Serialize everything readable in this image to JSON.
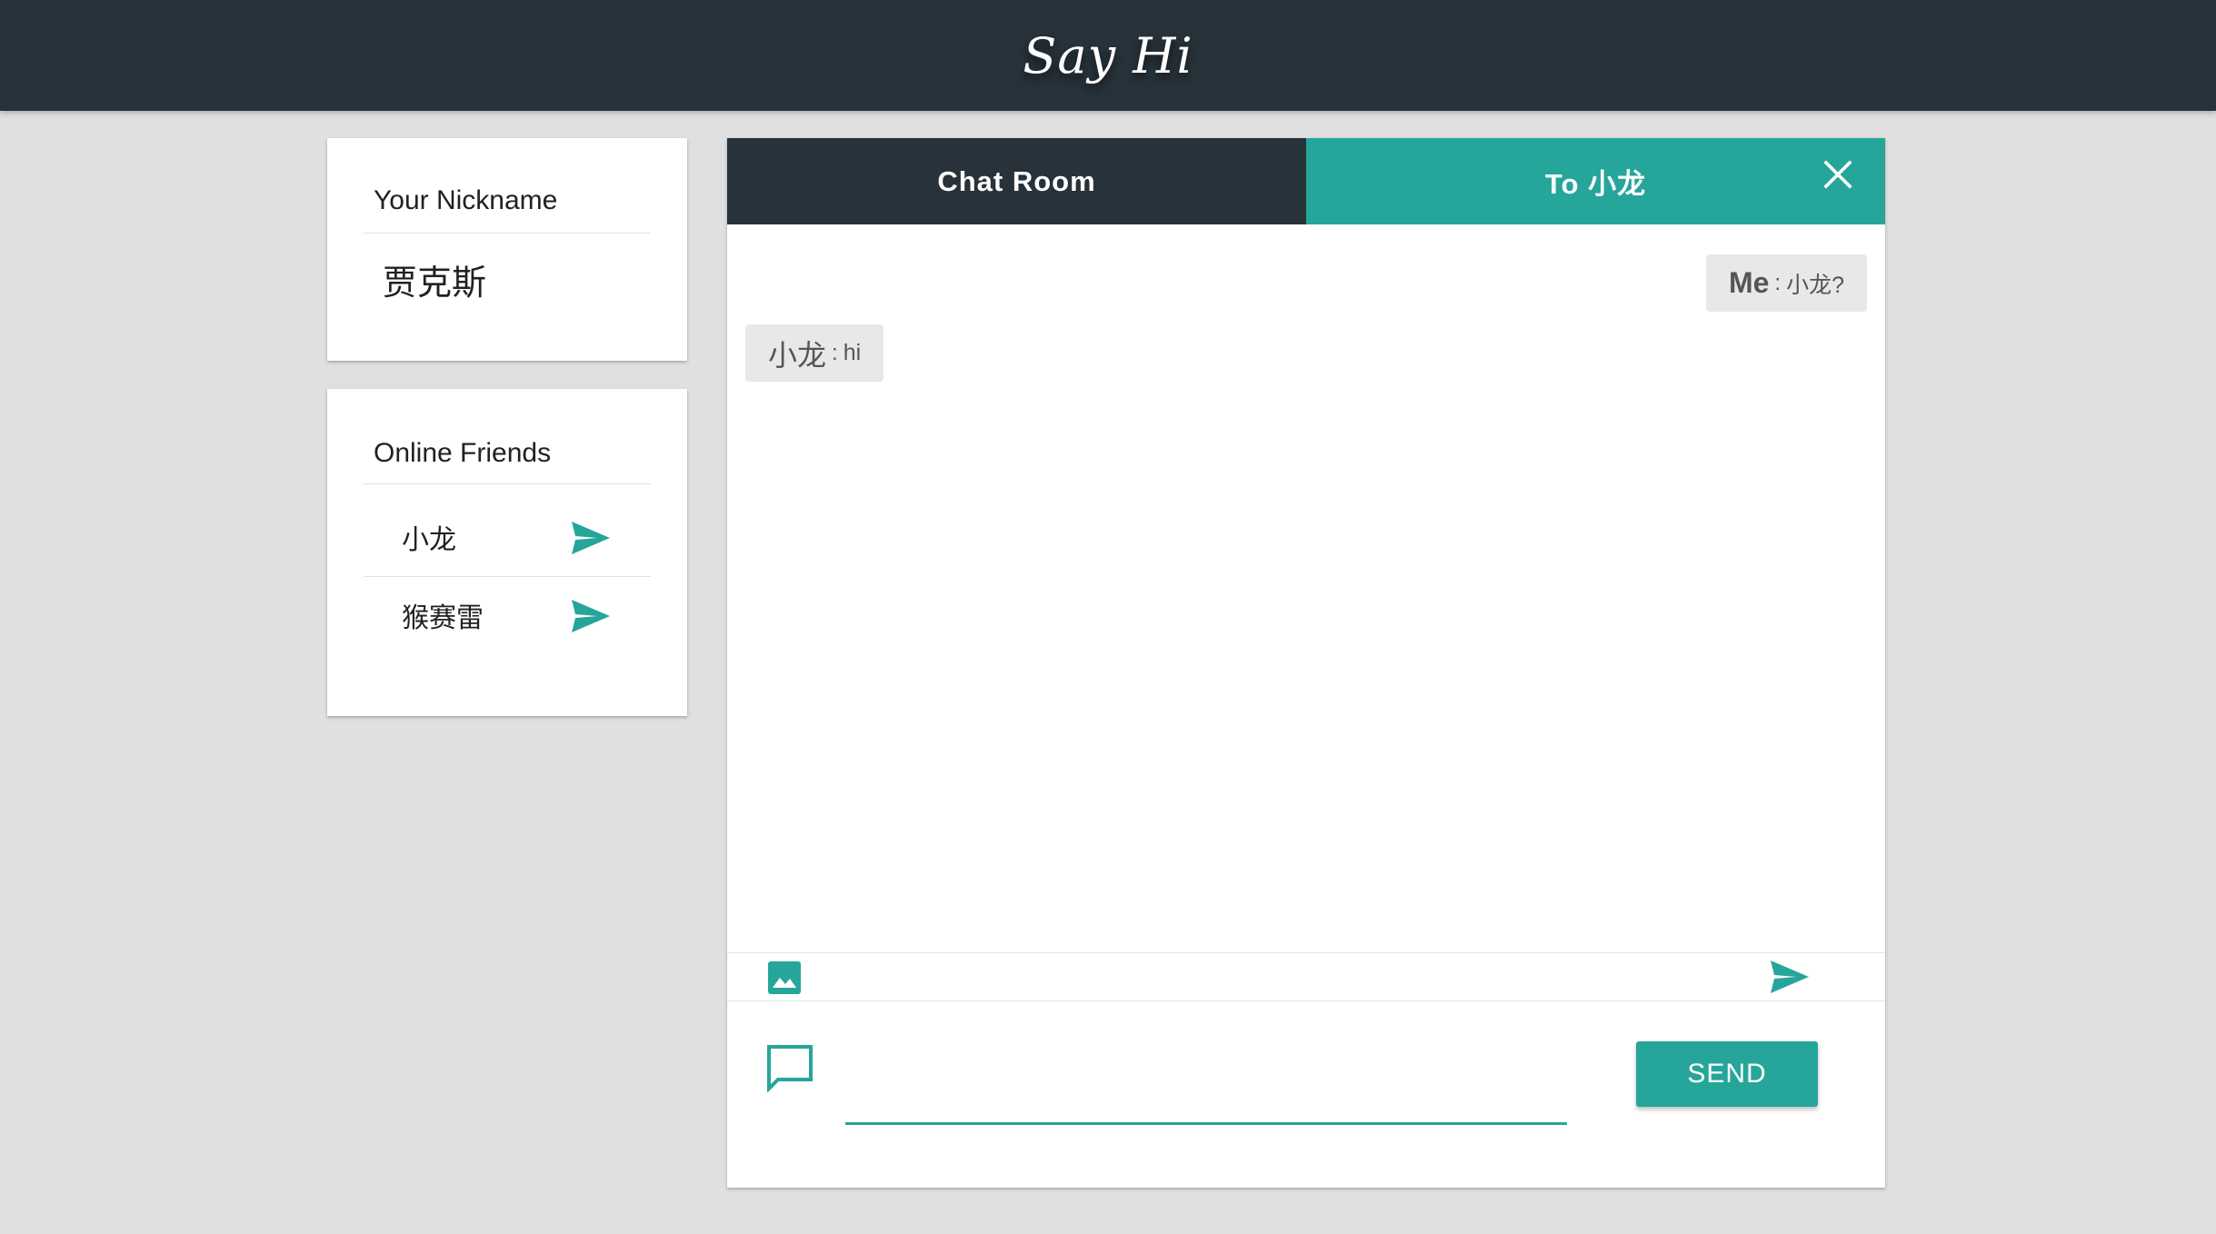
{
  "header": {
    "title": "Say Hi"
  },
  "nickname_card": {
    "title": "Your Nickname",
    "value": "贾克斯"
  },
  "friends_card": {
    "title": "Online Friends",
    "friends": [
      {
        "name": "小龙",
        "icon": "send-icon"
      },
      {
        "name": "猴赛雷",
        "icon": "send-icon"
      }
    ]
  },
  "chat": {
    "tabs": [
      {
        "label": "Chat Room"
      },
      {
        "label": "To 小龙",
        "icon": "close-icon"
      }
    ],
    "messages": [
      {
        "direction": "outgoing",
        "sender": "Me",
        "separator": ":",
        "text": "小龙?"
      },
      {
        "direction": "incoming",
        "sender": "小龙",
        "separator": ":",
        "text": "hi"
      }
    ],
    "toolbar": {
      "image_icon": "image-icon",
      "send_icon": "send-icon"
    },
    "compose": {
      "icon": "chat-bubble-icon",
      "input_value": "",
      "send_label": "SEND"
    }
  },
  "colors": {
    "header_bg": "#27323a",
    "accent": "#26a69a",
    "page_bg": "#e0e0e0",
    "bubble_bg": "#e8e8e8"
  }
}
